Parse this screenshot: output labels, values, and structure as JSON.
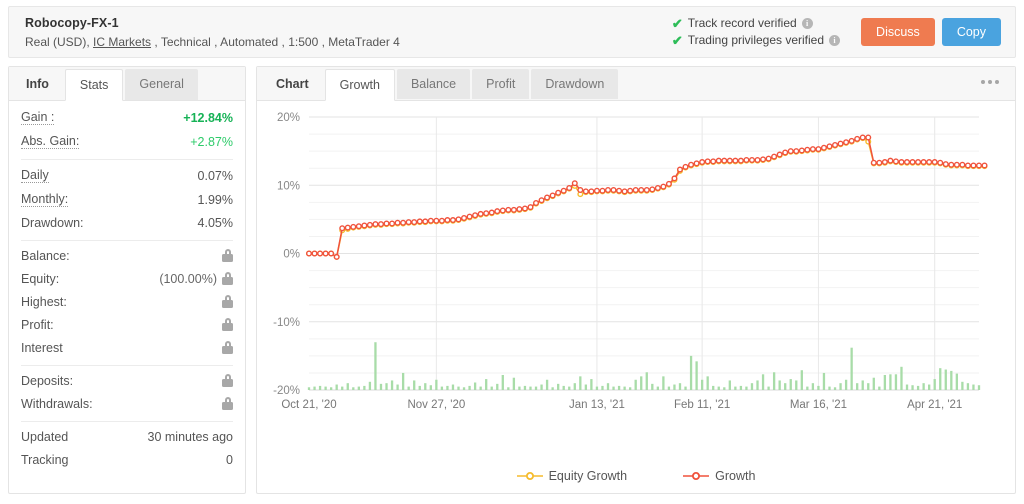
{
  "header": {
    "account_name": "Robocopy-FX-1",
    "meta_prefix": "Real (USD), ",
    "broker": "IC Markets",
    "meta_suffix": " , Technical , Automated , 1:500 , MetaTrader 4",
    "verifications": [
      {
        "label": "Track record verified",
        "icon": "check-icon",
        "info": "i"
      },
      {
        "label": "Trading privileges verified",
        "icon": "check-icon",
        "info": "i"
      }
    ],
    "buttons": {
      "discuss": "Discuss",
      "copy": "Copy"
    },
    "colors": {
      "discuss": "#ef7b50",
      "copy": "#4aa3df",
      "check": "#2ebd59"
    }
  },
  "sidebar": {
    "tabs": [
      {
        "label": "Info",
        "state": "plain"
      },
      {
        "label": "Stats",
        "state": "active"
      },
      {
        "label": "General",
        "state": "normal"
      }
    ],
    "groups": [
      {
        "rows": [
          {
            "label": "Gain :",
            "value": "+12.84%",
            "style": "green-b",
            "underline": "dotted",
            "lock": false
          },
          {
            "label": "Abs. Gain:",
            "value": "+2.87%",
            "style": "green",
            "underline": "dotted",
            "lock": false
          }
        ]
      },
      {
        "rows": [
          {
            "label": "Daily",
            "value": "0.07%",
            "style": "",
            "underline": "dotted",
            "lock": false
          },
          {
            "label": "Monthly:",
            "value": "1.99%",
            "style": "",
            "underline": "dotted",
            "lock": false
          },
          {
            "label": "Drawdown:",
            "value": "4.05%",
            "style": "",
            "underline": "none",
            "lock": false
          }
        ]
      },
      {
        "rows": [
          {
            "label": "Balance:",
            "value": "",
            "style": "",
            "underline": "none",
            "lock": true
          },
          {
            "label": "Equity:",
            "value": "(100.00%)",
            "style": "muted",
            "underline": "none",
            "lock": true
          },
          {
            "label": "Highest:",
            "value": "",
            "style": "",
            "underline": "none",
            "lock": true
          },
          {
            "label": "Profit:",
            "value": "",
            "style": "",
            "underline": "none",
            "lock": true
          },
          {
            "label": "Interest",
            "value": "",
            "style": "",
            "underline": "none",
            "lock": true
          }
        ]
      },
      {
        "rows": [
          {
            "label": "Deposits:",
            "value": "",
            "style": "",
            "underline": "none",
            "lock": true
          },
          {
            "label": "Withdrawals:",
            "value": "",
            "style": "",
            "underline": "none",
            "lock": true
          }
        ]
      },
      {
        "rows": [
          {
            "label": "Updated",
            "value": "30 minutes ago",
            "style": "",
            "underline": "none",
            "lock": false
          },
          {
            "label": "Tracking",
            "value": "0",
            "style": "",
            "underline": "none",
            "lock": false
          }
        ]
      }
    ]
  },
  "chart_panel": {
    "tabs": [
      {
        "label": "Chart",
        "state": "plain"
      },
      {
        "label": "Growth",
        "state": "active"
      },
      {
        "label": "Balance",
        "state": "normal"
      },
      {
        "label": "Profit",
        "state": "normal"
      },
      {
        "label": "Drawdown",
        "state": "normal"
      }
    ],
    "menu_icon": "more-options-icon"
  },
  "chart_data": {
    "type": "line",
    "title": "",
    "xlabel": "",
    "ylabel": "",
    "ylim": [
      -20,
      20
    ],
    "ytick_labels": [
      "20%",
      "10%",
      "0%",
      "-10%",
      "-20%"
    ],
    "yticks": [
      20,
      10,
      0,
      -10,
      -20
    ],
    "grid": true,
    "legend_position": "bottom",
    "xtick_labels": [
      "Oct 21, '20",
      "Nov 27, '20",
      "Jan 13, '21",
      "Feb 11, '21",
      "Mar 16, '21",
      "Apr 21, '21"
    ],
    "xtick_positions": [
      0,
      23,
      52,
      71,
      92,
      113
    ],
    "n_points": 122,
    "series": [
      {
        "name": "Growth",
        "color": "#f0523c",
        "marker": "circle-open",
        "values": [
          0,
          0,
          0,
          0,
          0,
          -0.5,
          3.7,
          3.8,
          3.9,
          4.0,
          4.1,
          4.2,
          4.3,
          4.3,
          4.4,
          4.4,
          4.5,
          4.5,
          4.6,
          4.6,
          4.7,
          4.7,
          4.8,
          4.8,
          4.8,
          4.9,
          4.9,
          5.0,
          5.2,
          5.4,
          5.6,
          5.8,
          5.9,
          6.0,
          6.2,
          6.3,
          6.4,
          6.4,
          6.5,
          6.6,
          6.8,
          7.4,
          7.8,
          8.2,
          8.5,
          8.9,
          9.2,
          9.6,
          10.3,
          9.3,
          9.1,
          9.1,
          9.2,
          9.2,
          9.3,
          9.3,
          9.2,
          9.1,
          9.2,
          9.3,
          9.3,
          9.3,
          9.4,
          9.6,
          9.8,
          10.2,
          11.0,
          12.3,
          12.7,
          13.0,
          13.2,
          13.4,
          13.5,
          13.5,
          13.6,
          13.6,
          13.6,
          13.6,
          13.6,
          13.7,
          13.7,
          13.7,
          13.8,
          13.9,
          14.2,
          14.5,
          14.8,
          15.0,
          15.0,
          15.1,
          15.2,
          15.3,
          15.3,
          15.5,
          15.7,
          15.9,
          16.1,
          16.3,
          16.5,
          16.8,
          17.0,
          17.0,
          13.3,
          13.3,
          13.4,
          13.6,
          13.5,
          13.4,
          13.4,
          13.4,
          13.4,
          13.4,
          13.4,
          13.4,
          13.3,
          13.1,
          13.0,
          13.0,
          13.0,
          12.9,
          12.9,
          12.9,
          12.9
        ]
      },
      {
        "name": "Equity Growth",
        "color": "#f5bc2e",
        "marker": "circle-open",
        "values": [
          0,
          0,
          0,
          0,
          0,
          -0.5,
          3.4,
          3.6,
          3.8,
          3.9,
          4.0,
          4.1,
          4.2,
          4.2,
          4.3,
          4.3,
          4.4,
          4.4,
          4.5,
          4.5,
          4.6,
          4.6,
          4.7,
          4.7,
          4.7,
          4.8,
          4.8,
          4.9,
          5.1,
          5.3,
          5.5,
          5.7,
          5.8,
          5.9,
          6.1,
          6.2,
          6.3,
          6.3,
          6.4,
          6.5,
          6.7,
          7.3,
          7.7,
          8.1,
          8.4,
          8.8,
          9.1,
          9.5,
          9.9,
          8.7,
          9.0,
          9.0,
          9.1,
          9.1,
          9.2,
          9.2,
          9.1,
          9.0,
          9.1,
          9.2,
          9.2,
          9.2,
          9.3,
          9.5,
          9.7,
          10.1,
          10.8,
          12.1,
          12.6,
          12.9,
          13.1,
          13.3,
          13.4,
          13.4,
          13.5,
          13.5,
          13.5,
          13.5,
          13.5,
          13.6,
          13.6,
          13.6,
          13.7,
          13.8,
          14.1,
          14.4,
          14.7,
          14.9,
          14.9,
          15.0,
          15.1,
          15.2,
          15.2,
          15.4,
          15.6,
          15.8,
          16.0,
          16.2,
          16.4,
          16.7,
          16.9,
          16.4,
          13.2,
          13.2,
          13.3,
          13.5,
          13.4,
          13.3,
          13.3,
          13.3,
          13.3,
          13.3,
          13.3,
          13.3,
          13.2,
          13.0,
          12.9,
          12.9,
          12.9,
          12.8,
          12.8,
          12.8,
          12.8
        ]
      }
    ],
    "bars": {
      "name": "Volume",
      "color": "#a8dca8",
      "baseline": -20,
      "values": [
        0.4,
        0.5,
        0.6,
        0.5,
        0.4,
        0.8,
        0.5,
        1.0,
        0.4,
        0.5,
        0.6,
        1.2,
        7.0,
        0.9,
        1.0,
        1.4,
        0.8,
        2.5,
        0.5,
        1.4,
        0.6,
        1.0,
        0.7,
        1.5,
        0.5,
        0.6,
        0.8,
        0.5,
        0.4,
        0.6,
        1.1,
        0.5,
        1.6,
        0.5,
        0.9,
        2.2,
        0.4,
        1.8,
        0.5,
        0.6,
        0.5,
        0.5,
        0.8,
        1.5,
        0.4,
        0.9,
        0.6,
        0.5,
        1.0,
        2.0,
        0.8,
        1.6,
        0.5,
        0.6,
        1.0,
        0.5,
        0.6,
        0.5,
        0.4,
        1.5,
        2.0,
        2.6,
        0.9,
        0.5,
        2.0,
        0.5,
        0.8,
        1.0,
        0.5,
        5.0,
        4.2,
        1.5,
        2.0,
        0.6,
        0.5,
        0.4,
        1.4,
        0.5,
        0.6,
        0.5,
        1.0,
        1.4,
        2.3,
        0.5,
        2.6,
        1.4,
        1.0,
        1.6,
        1.4,
        2.9,
        0.5,
        1.0,
        0.6,
        2.5,
        0.5,
        0.4,
        1.0,
        1.5,
        6.2,
        1.0,
        1.4,
        1.0,
        1.8,
        0.5,
        2.2,
        2.3,
        2.3,
        3.4,
        0.8,
        0.7,
        0.6,
        1.0,
        0.8,
        1.6,
        3.2,
        3.0,
        2.8,
        2.4,
        1.2,
        1.0,
        0.8,
        0.7
      ]
    }
  }
}
